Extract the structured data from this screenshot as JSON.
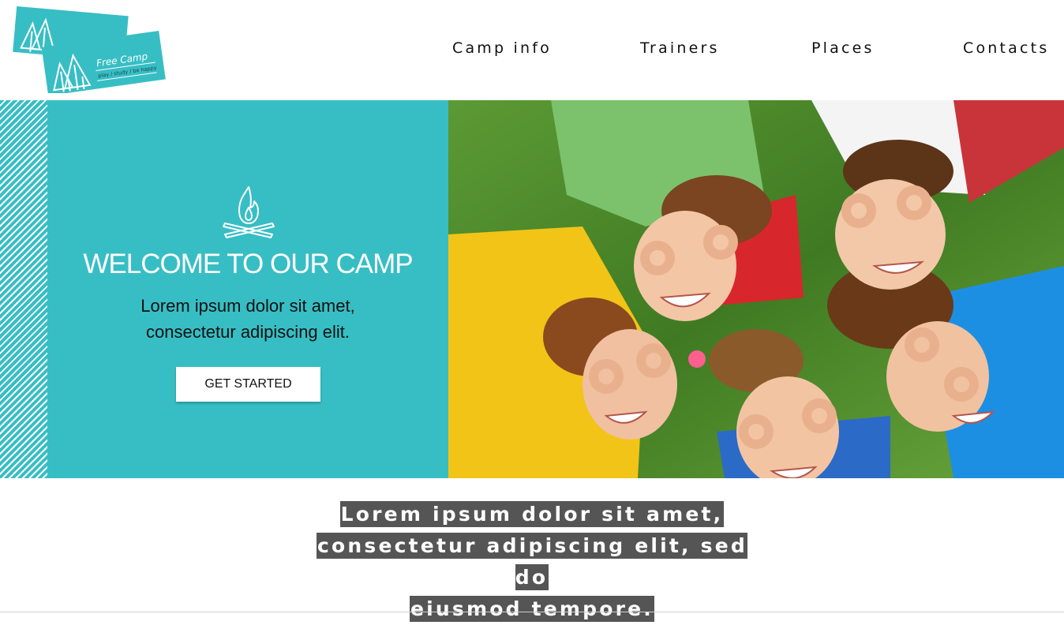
{
  "logo": {
    "title": "Free Camp",
    "tagline": "play / study / be happy"
  },
  "nav": {
    "items": [
      {
        "label": "Camp info"
      },
      {
        "label": "Trainers"
      },
      {
        "label": "Places"
      },
      {
        "label": "Contacts"
      }
    ]
  },
  "hero": {
    "title": "WELCOME TO OUR CAMP",
    "subtitle_line1": "Lorem ipsum dolor sit amet,",
    "subtitle_line2": "consectetur adipiscing elit.",
    "cta_label": "GET STARTED",
    "icon": "campfire-icon",
    "photo": "kids-in-grass-photo"
  },
  "tagline": {
    "line1": "Lorem ipsum dolor sit amet,",
    "line2": "consectetur adipiscing elit, sed do",
    "line3": "eiusmod tempore."
  },
  "colors": {
    "accent": "#37bec4",
    "highlight_bg": "#555555",
    "text": "#111111"
  }
}
